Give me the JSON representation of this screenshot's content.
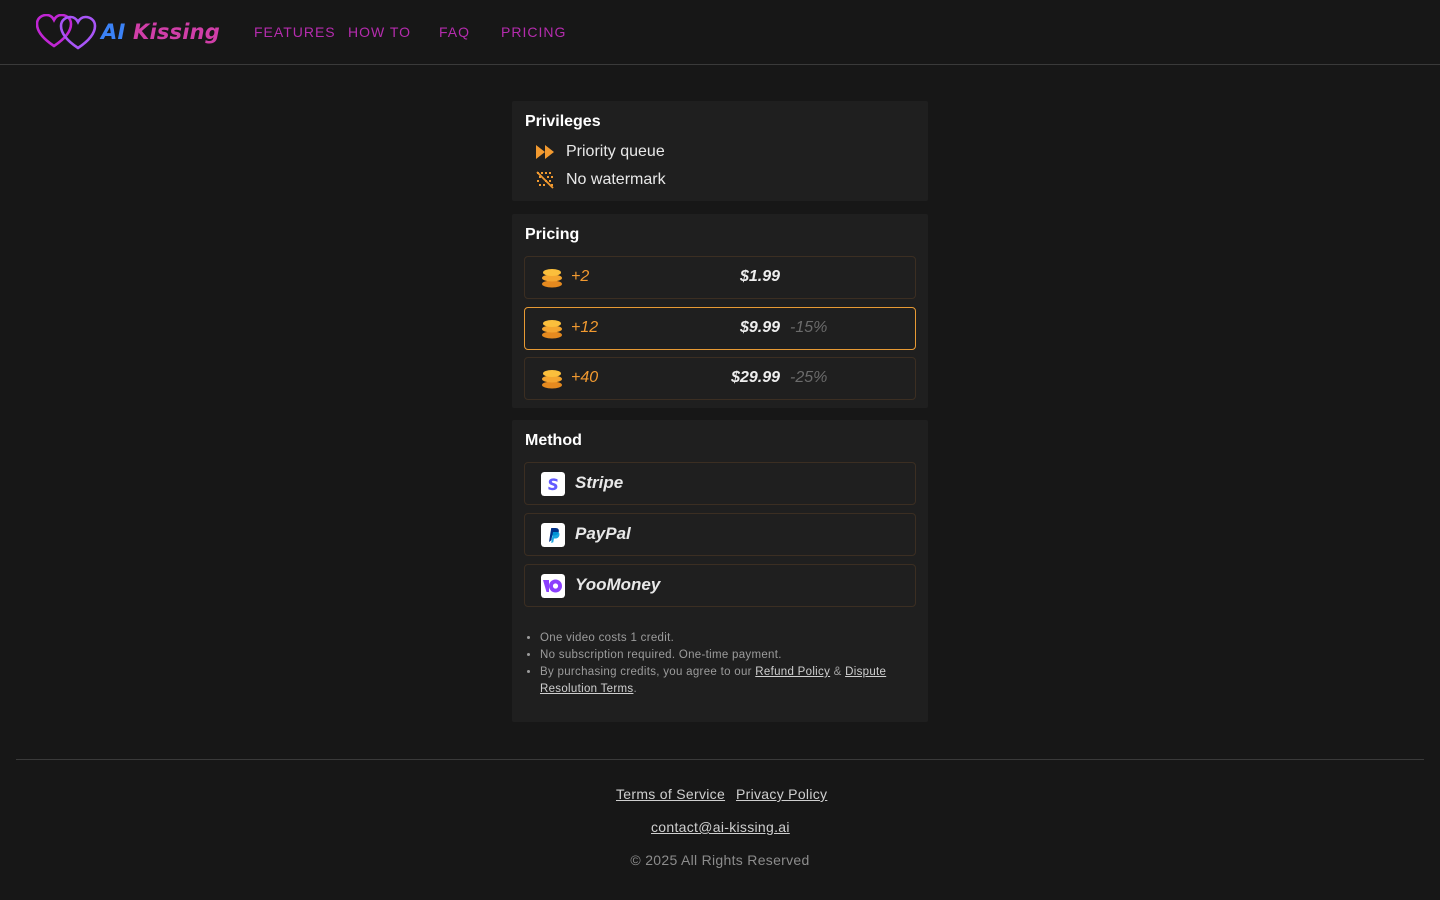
{
  "header": {
    "logo_alt": "AI Kissing",
    "logo_text_ai": "AI",
    "logo_text_kissing": "Kissing",
    "nav": [
      {
        "label": "FEATURES"
      },
      {
        "label": "HOW TO"
      },
      {
        "label": "FAQ"
      },
      {
        "label": "PRICING"
      }
    ]
  },
  "privileges": {
    "title": "Privileges",
    "items": [
      {
        "label": "Priority queue",
        "icon": "fast-forward-icon"
      },
      {
        "label": "No watermark",
        "icon": "no-watermark-icon"
      }
    ]
  },
  "pricing": {
    "title": "Pricing",
    "options": [
      {
        "credits": "+2",
        "price": "$1.99",
        "discount": "",
        "selected": false
      },
      {
        "credits": "+12",
        "price": "$9.99",
        "discount": "-15%",
        "selected": true
      },
      {
        "credits": "+40",
        "price": "$29.99",
        "discount": "-25%",
        "selected": false
      }
    ]
  },
  "method": {
    "title": "Method",
    "options": [
      {
        "name": "Stripe",
        "icon": "stripe-icon"
      },
      {
        "name": "PayPal",
        "icon": "paypal-icon"
      },
      {
        "name": "YooMoney",
        "icon": "yoomoney-icon"
      }
    ]
  },
  "notes": {
    "line1": "One video costs 1 credit.",
    "line2": "No subscription required. One-time payment.",
    "line3_prefix": "By purchasing credits, you agree to our ",
    "refund_policy": "Refund Policy",
    "amp": " & ",
    "dispute_terms": "Dispute Resolution Terms",
    "line3_suffix": "."
  },
  "footer": {
    "terms": "Terms of Service",
    "privacy": "Privacy Policy",
    "contact": "contact@ai-kissing.ai",
    "copyright": "© 2025 All Rights Reserved"
  },
  "colors": {
    "background": "#171717",
    "card": "#1f1f1f",
    "accent_orange": "#f29a30",
    "nav_purple": "#b52cae",
    "logo_blue": "#3b82f6",
    "logo_pink": "#d03ea8"
  }
}
